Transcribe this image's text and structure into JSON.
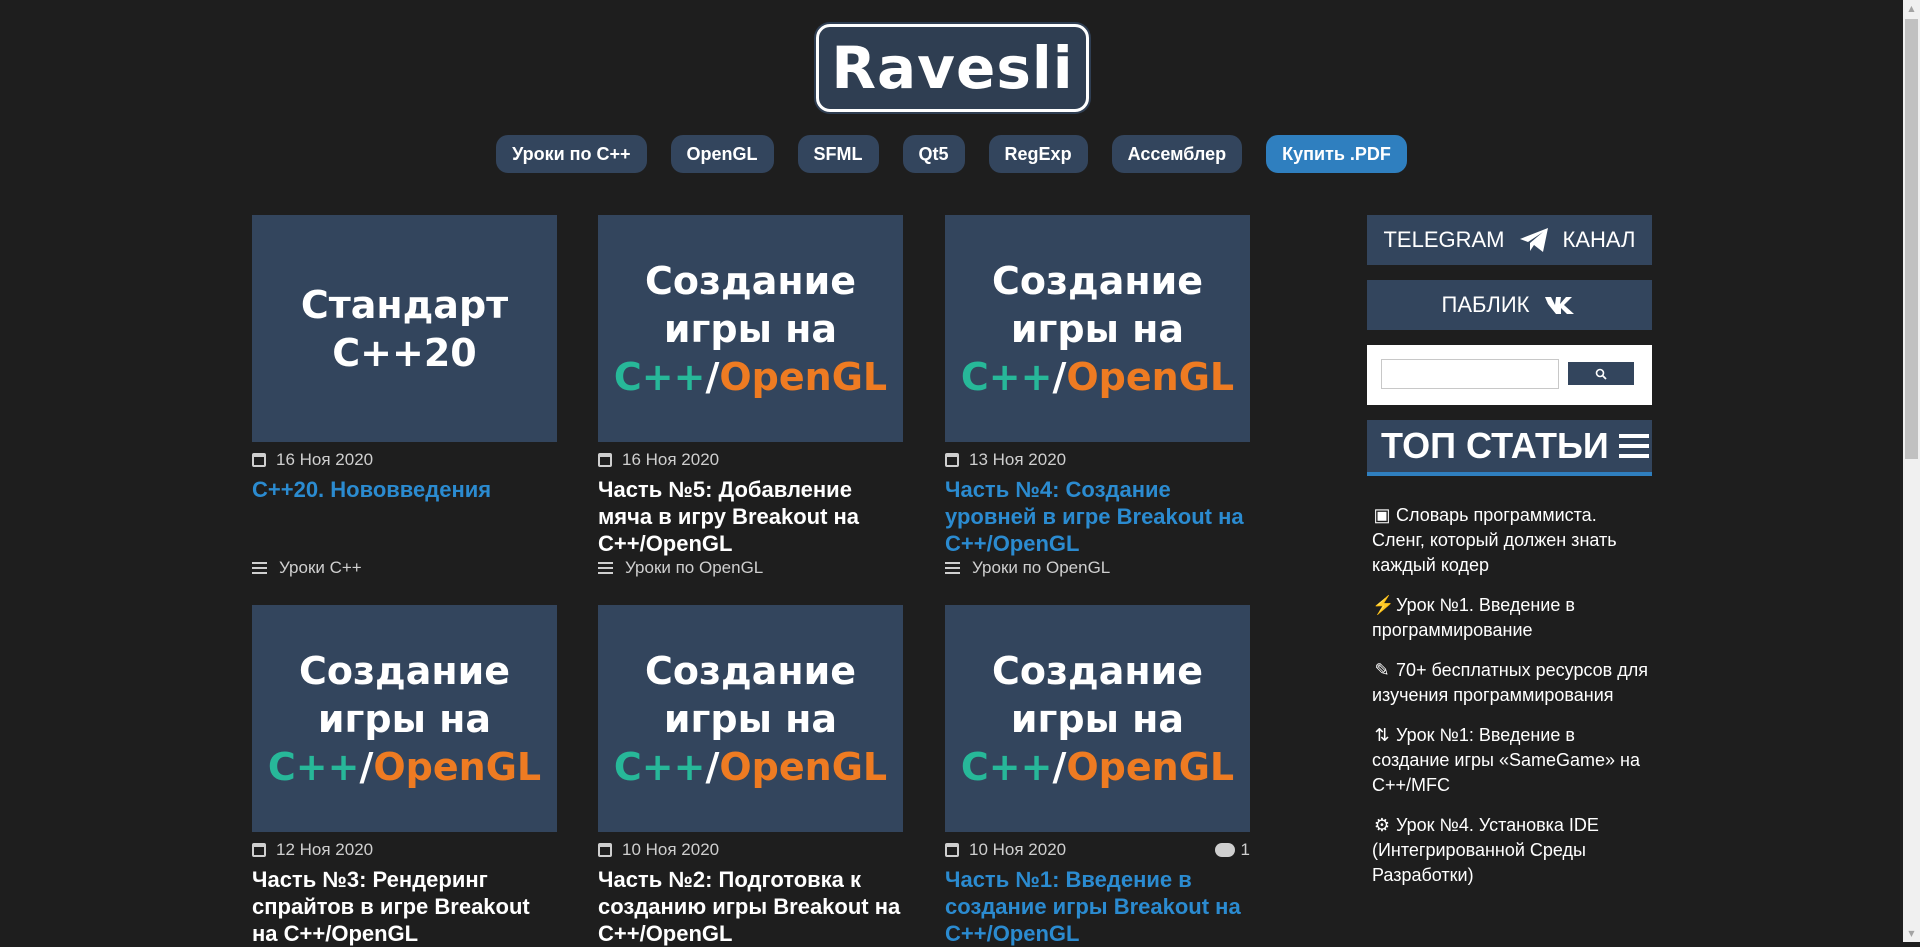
{
  "logo": {
    "text": "Ravesli"
  },
  "nav": [
    {
      "label": "Уроки по C++"
    },
    {
      "label": "OpenGL"
    },
    {
      "label": "SFML"
    },
    {
      "label": "Qt5"
    },
    {
      "label": "RegExp"
    },
    {
      "label": "Ассемблер"
    },
    {
      "label": "Купить .PDF"
    }
  ],
  "cards": [
    {
      "thumb": [
        "Стандарт",
        "C++20",
        ""
      ],
      "date": "16 Ноя 2020",
      "title": "C++20. Нововведения",
      "category": "Уроки C++",
      "comments": ""
    },
    {
      "thumb": [
        "Создание",
        "игры на",
        "C++/OpenGL"
      ],
      "date": "16 Ноя 2020",
      "title": "Часть №5: Добавление мяча в игру Breakout на C++/OpenGL",
      "category": "Уроки по OpenGL",
      "comments": ""
    },
    {
      "thumb": [
        "Создание",
        "игры на",
        "C++/OpenGL"
      ],
      "date": "13 Ноя 2020",
      "title": "Часть №4: Создание уровней в игре Breakout на C++/OpenGL",
      "category": "Уроки по OpenGL",
      "comments": ""
    },
    {
      "thumb": [
        "Создание",
        "игры на",
        "C++/OpenGL"
      ],
      "date": "12 Ноя 2020",
      "title": "Часть №3: Рендеринг спрайтов в игре Breakout на C++/OpenGL",
      "category": "",
      "comments": ""
    },
    {
      "thumb": [
        "Создание",
        "игры на",
        "C++/OpenGL"
      ],
      "date": "10 Ноя 2020",
      "title": "Часть №2: Подготовка к созданию игры Breakout на C++/OpenGL",
      "category": "",
      "comments": ""
    },
    {
      "thumb": [
        "Создание",
        "игры на",
        "C++/OpenGL"
      ],
      "date": "10 Ноя 2020",
      "title": "Часть №1: Введение в создание игры Breakout на C++/OpenGL",
      "category": "",
      "comments": "1"
    }
  ],
  "sidebar": {
    "telegram_left": "TELEGRAM",
    "telegram_right": "КАНАЛ",
    "vk_label": "ПАБЛИК",
    "search_placeholder": "",
    "top_title": "ТОП СТАТЬИ",
    "top_items": [
      {
        "icon": "book-icon",
        "text": "Словарь программиста. Сленг, который должен знать каждый кодер"
      },
      {
        "icon": "plug-icon",
        "text": "Урок №1. Введение в программирование"
      },
      {
        "icon": "pencil-icon",
        "text": "70+ бесплатных ресурсов для изучения программирования"
      },
      {
        "icon": "sort-icon",
        "text": "Урок №1: Введение в создание игры «SameGame» на C++/MFC"
      },
      {
        "icon": "gear-icon",
        "text": "Урок №4. Установка IDE (Интегрированной Среды Разработки)"
      }
    ]
  },
  "colors": {
    "background": "#1e1e1e",
    "panel": "#33455d",
    "accent_blue": "#2f7fbf",
    "link": "#2b8bd0",
    "teal": "#27b899",
    "orange": "#ee7b22"
  }
}
